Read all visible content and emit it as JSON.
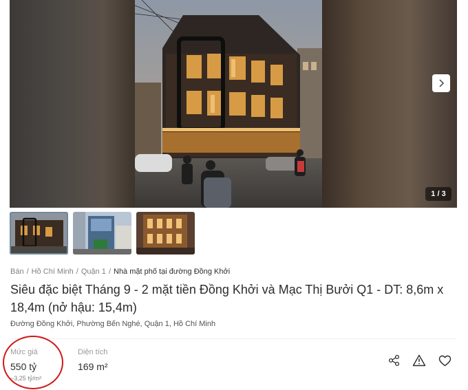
{
  "gallery": {
    "counter": "1 / 3"
  },
  "breadcrumb": [
    "Bán",
    "Hồ Chí Minh",
    "Quận 1",
    "Nhà mặt phố tại đường Đồng Khởi"
  ],
  "listing": {
    "title": "Siêu đặc biệt Tháng 9 - 2 mặt tiền Đồng Khởi và Mạc Thị Bưởi Q1 - DT: 8,6m x 18,4m (nở hậu: 15,4m)",
    "address": "Đường Đồng Khởi, Phường Bến Nghé, Quận 1, Hồ Chí Minh"
  },
  "stats": {
    "price_label": "Mức giá",
    "price_value": "550 tỷ",
    "price_per_m2": "~3,25 tỷ/m²",
    "area_label": "Diện tích",
    "area_value": "169 m²"
  },
  "icons": {
    "share": "share-icon",
    "report": "warning-icon",
    "save": "heart-icon",
    "next": "chevron-right-icon"
  },
  "colors": {
    "annotation_circle": "#d01818",
    "text_primary": "#2c2c2c",
    "text_muted": "#999999"
  }
}
